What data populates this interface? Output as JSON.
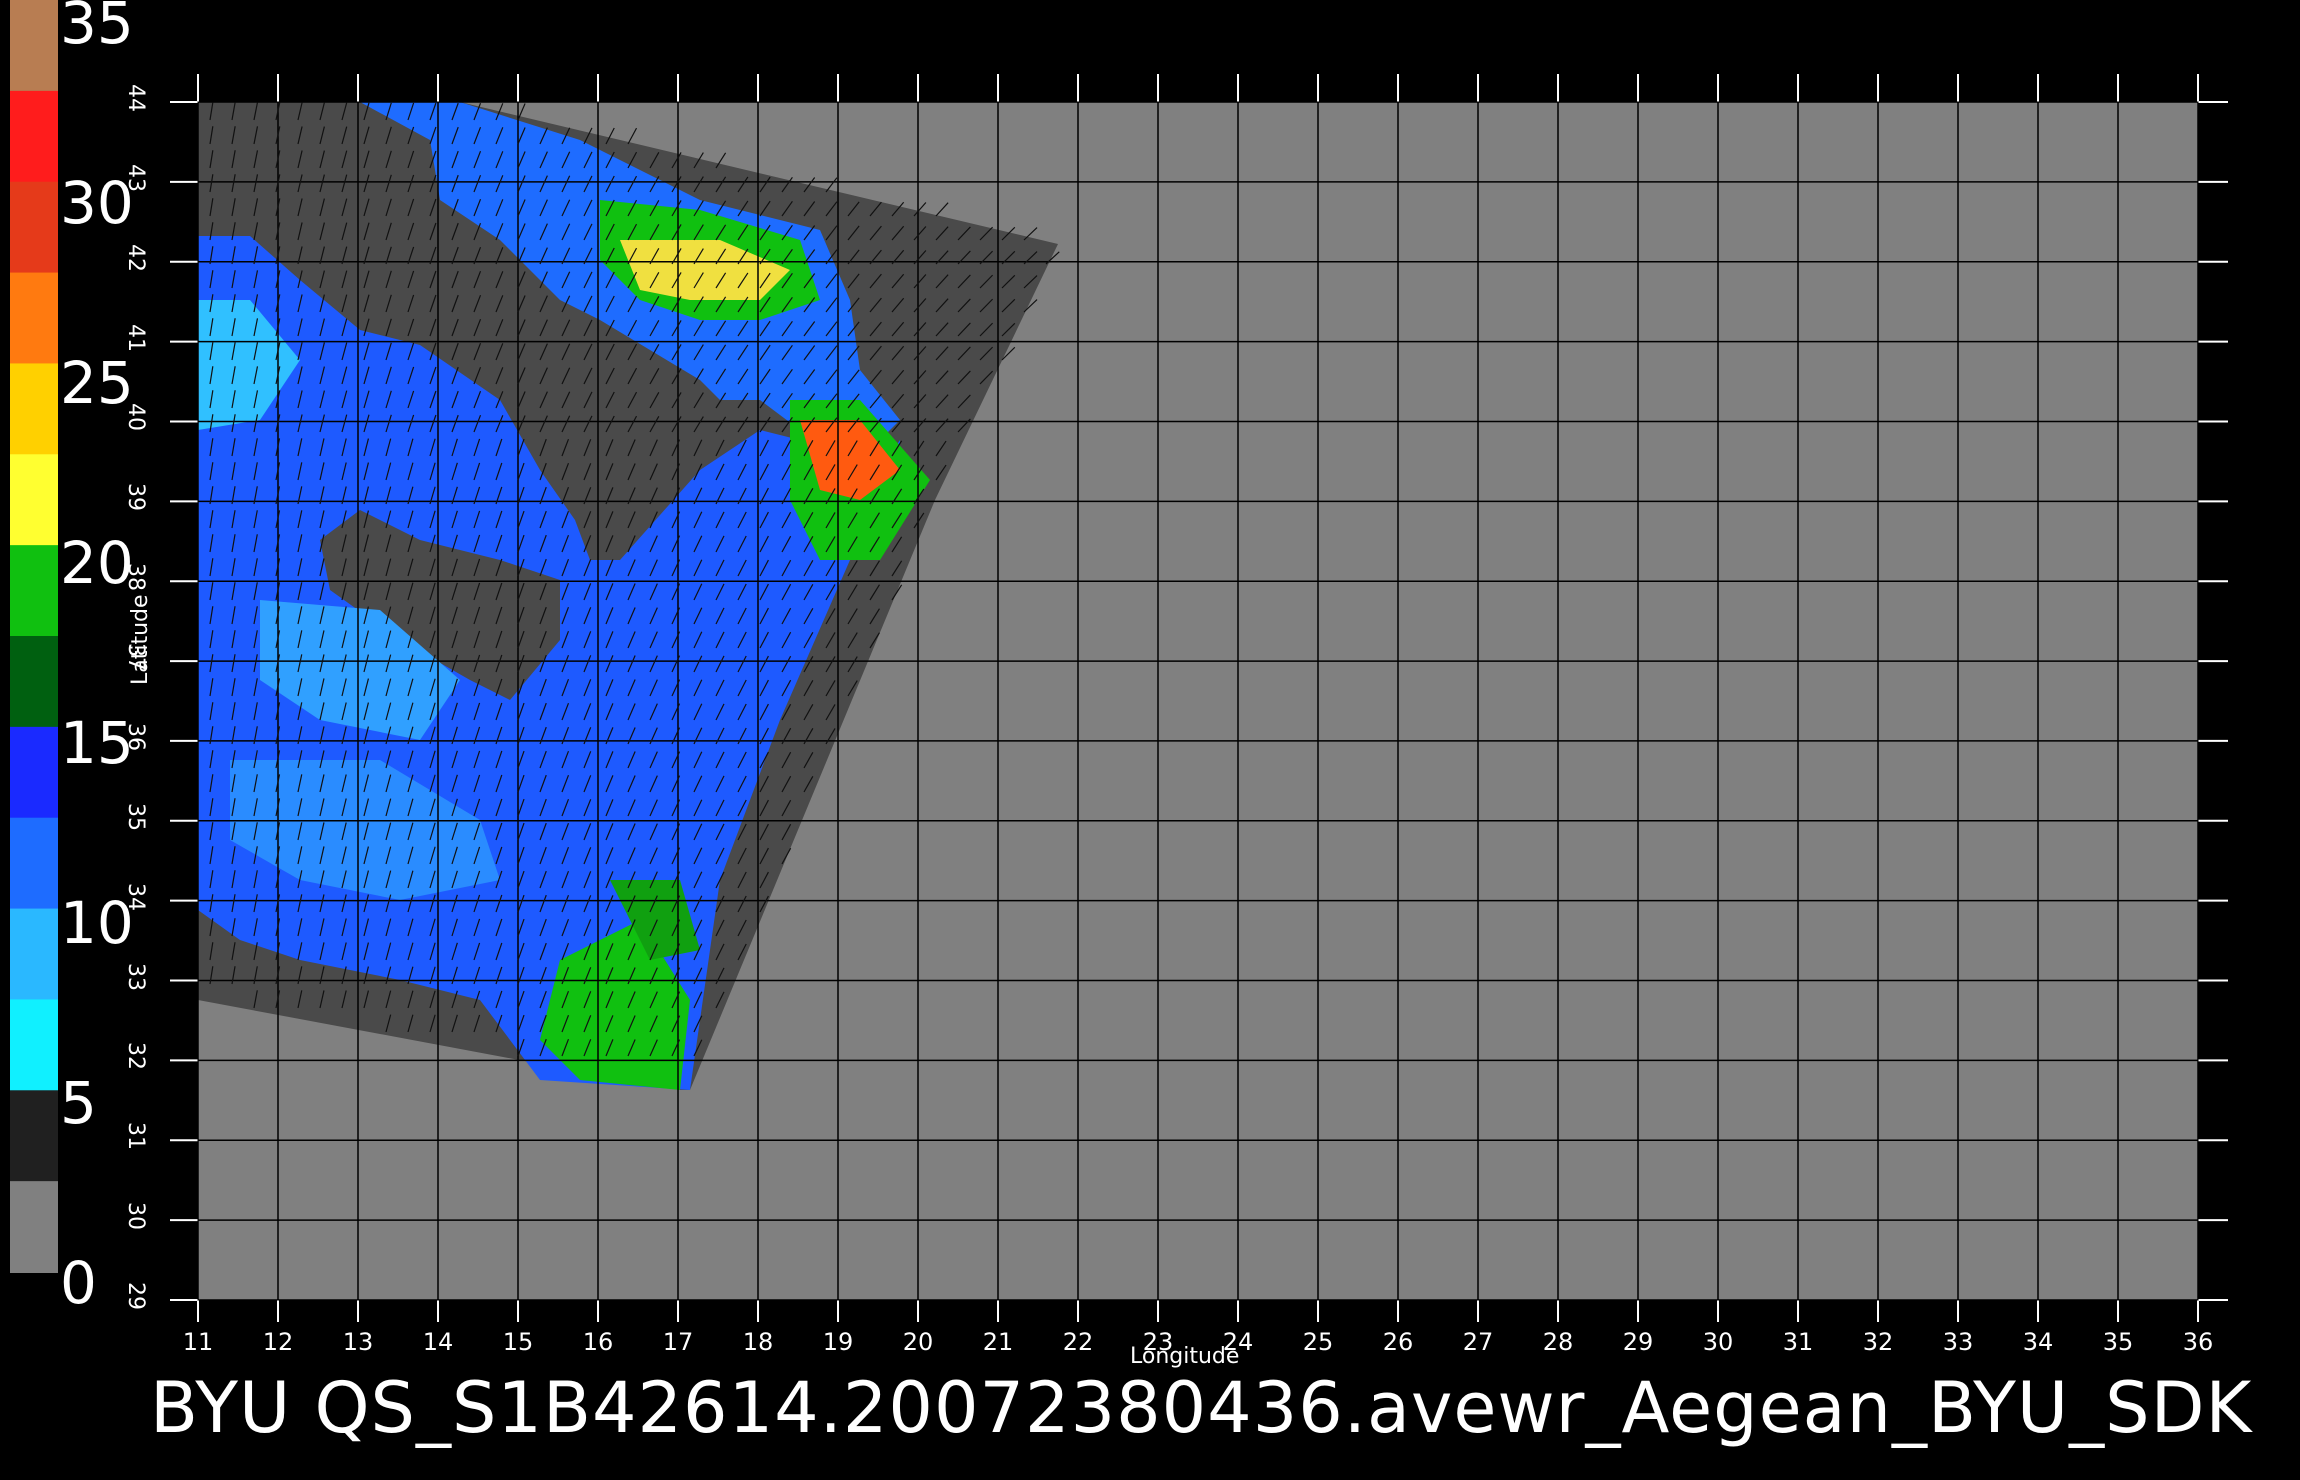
{
  "colorbar": {
    "labels": [
      "35",
      "30",
      "25",
      "20",
      "15",
      "10",
      "5",
      "0"
    ],
    "stops": [
      "#b87d52",
      "#ff1c1c",
      "#e53a1a",
      "#ff7a10",
      "#ffd000",
      "#ffff30",
      "#10c010",
      "#006010",
      "#1a2aff",
      "#1e6cff",
      "#2ab8ff",
      "#10f0ff",
      "#202020",
      "#808080"
    ]
  },
  "map": {
    "background": "#808080",
    "swath_color": "#4a4a4a",
    "x_axis": {
      "title": "Longitude",
      "range": [
        11,
        36
      ],
      "ticks": [
        "11",
        "12",
        "13",
        "14",
        "15",
        "16",
        "17",
        "18",
        "19",
        "20",
        "21",
        "22",
        "23",
        "24",
        "25",
        "26",
        "27",
        "28",
        "29",
        "30",
        "31",
        "32",
        "33",
        "34",
        "35",
        "36"
      ]
    },
    "y_axis": {
      "title": "Latitude",
      "range": [
        29,
        44
      ],
      "ticks": [
        "29",
        "30",
        "31",
        "32",
        "33",
        "34",
        "35",
        "36",
        "37",
        "38",
        "39",
        "40",
        "41",
        "42",
        "43",
        "44"
      ]
    }
  },
  "footer": {
    "title": "BYU  QS_S1B42614.20072380436.avewr_Aegean_BYU_SDK"
  }
}
